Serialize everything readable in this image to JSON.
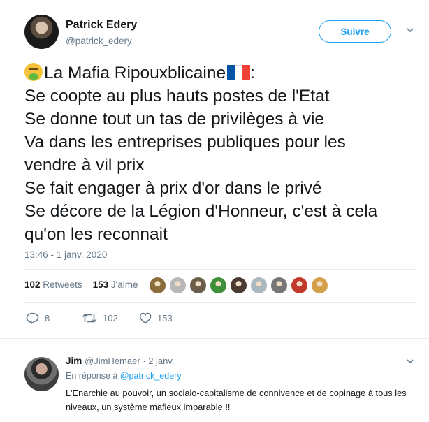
{
  "tweet": {
    "author_name": "Patrick Edery",
    "author_handle": "@patrick_edery",
    "follow_label": "Suivre",
    "lines": [
      "La Mafia Ripouxblicaine",
      "Se coopte au plus hauts postes de l'Etat",
      "Se donne tout un tas de privilèges à vie",
      "Va dans les entreprises publiques pour les",
      "vendre à vil prix",
      "Se fait engager à prix d'or dans le privé",
      "Se décore de la Légion d'Honneur, c'est à cela",
      "qu'on les reconnait"
    ],
    "first_line_suffix": ":",
    "timestamp": "13:46 - 1 janv. 2020",
    "retweets_count": "102",
    "retweets_label": "Retweets",
    "likes_count": "153",
    "likes_label": "J'aime",
    "actions": {
      "reply_count": "8",
      "retweet_count": "102",
      "like_count": "153"
    },
    "flag_colors": [
      "#0055a4",
      "#ffffff",
      "#ef4135"
    ],
    "liker_avatars": [
      {
        "icon": "liker-avatar-1-icon",
        "color": "#8a6d3b"
      },
      {
        "icon": "liker-avatar-2-icon",
        "color": "#b8b8b8"
      },
      {
        "icon": "liker-avatar-3-icon",
        "color": "#6b5e4a"
      },
      {
        "icon": "liker-avatar-4-icon",
        "color": "#3f8f3a"
      },
      {
        "icon": "liker-avatar-5-icon",
        "color": "#4a3a30"
      },
      {
        "icon": "liker-avatar-6-icon",
        "color": "#aab8c2"
      },
      {
        "icon": "liker-avatar-7-icon",
        "color": "#777777"
      },
      {
        "icon": "liker-avatar-8-icon",
        "color": "#c0392b"
      },
      {
        "icon": "liker-avatar-9-icon",
        "color": "#d4a04a"
      }
    ]
  },
  "reply": {
    "author_name": "Jim",
    "meta": "@JimHemaer · 2 janv.",
    "in_reply_prefix": "En réponse à",
    "in_reply_handle": "@patrick_edery",
    "text": "L'Enarchie au pouvoir, un socialo-capitalisme de connivence et de copinage à tous les niveaux, un système mafieux imparable !!"
  },
  "colors": {
    "accent": "#1da1f2",
    "secondary_text": "#657786",
    "divider": "#e6ecf0"
  }
}
